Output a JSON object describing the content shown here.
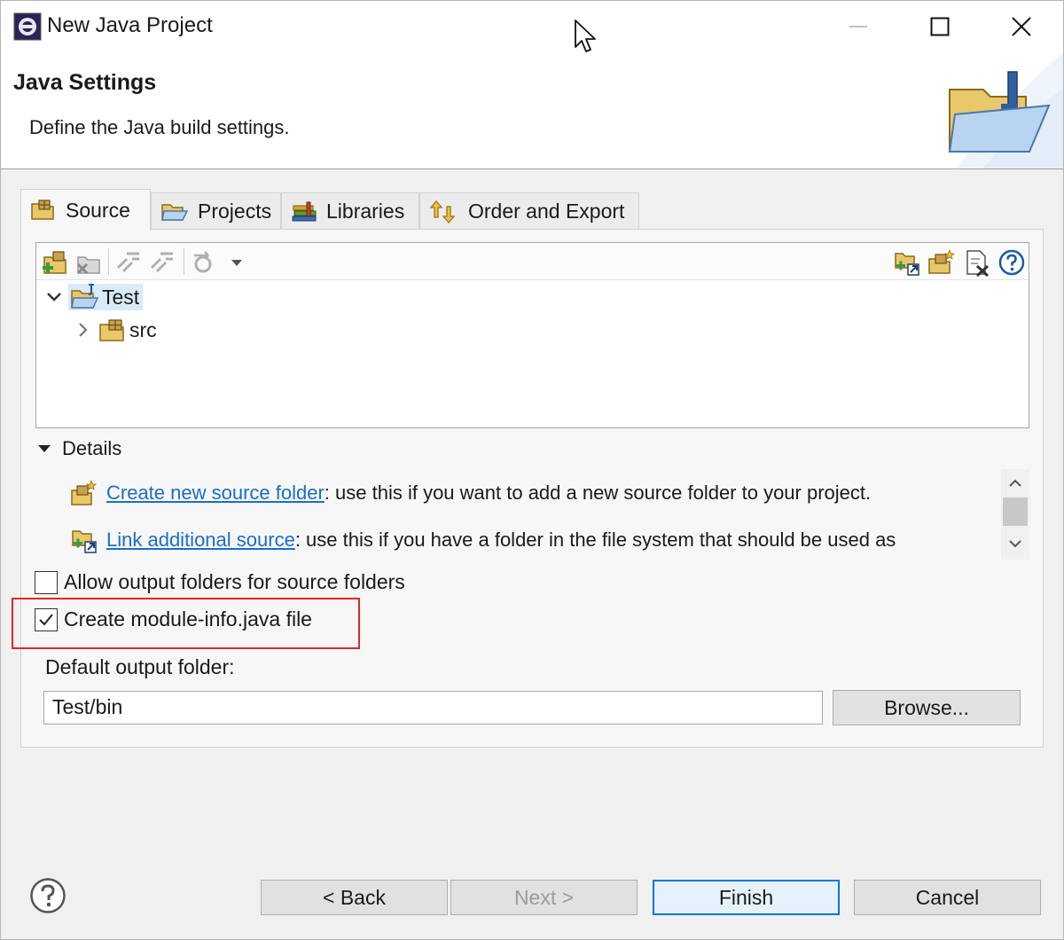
{
  "window": {
    "title": "New Java Project",
    "controls": {
      "minimize": "—",
      "maximize": "☐",
      "close": "✕"
    }
  },
  "header": {
    "title": "Java Settings",
    "description": "Define the Java build settings."
  },
  "tabs": [
    {
      "label": "Source",
      "icon": "source-folder-icon",
      "active": true
    },
    {
      "label": "Projects",
      "icon": "folder-open-icon",
      "active": false
    },
    {
      "label": "Libraries",
      "icon": "books-icon",
      "active": false
    },
    {
      "label": "Order and Export",
      "icon": "order-export-icon",
      "active": false
    }
  ],
  "toolbar": {
    "left_icons": [
      "add-source-folder-icon",
      "remove-source-folder-icon",
      "link-icon",
      "unlink-icon",
      "configure-icon",
      "dropdown-arrow-icon"
    ],
    "right_icons": [
      "link-folder-icon",
      "create-folder-icon",
      "remove-icon",
      "help-icon"
    ]
  },
  "tree": {
    "project": {
      "label": "Test",
      "expanded": true,
      "selected": true
    },
    "children": [
      {
        "label": "src",
        "expanded": false
      }
    ]
  },
  "details": {
    "label": "Details",
    "items": [
      {
        "link": "Create new source folder",
        "text": ": use this if you want to add a new source folder to your project."
      },
      {
        "link": "Link additional source",
        "text": ": use this if you have a folder in the file system that should be used as"
      }
    ]
  },
  "options": {
    "allow_output_label": "Allow output folders for source folders",
    "allow_output_checked": false,
    "module_info_label": "Create module-info.java file",
    "module_info_checked": true
  },
  "output": {
    "label": "Default output folder:",
    "value": "Test/bin",
    "browse_label": "Browse..."
  },
  "footer": {
    "back_label": "< Back",
    "next_label": "Next >",
    "finish_label": "Finish",
    "cancel_label": "Cancel"
  },
  "colors": {
    "highlight_border": "#e0262c",
    "link": "#1a6fc4",
    "selection": "#d9ebf9"
  }
}
